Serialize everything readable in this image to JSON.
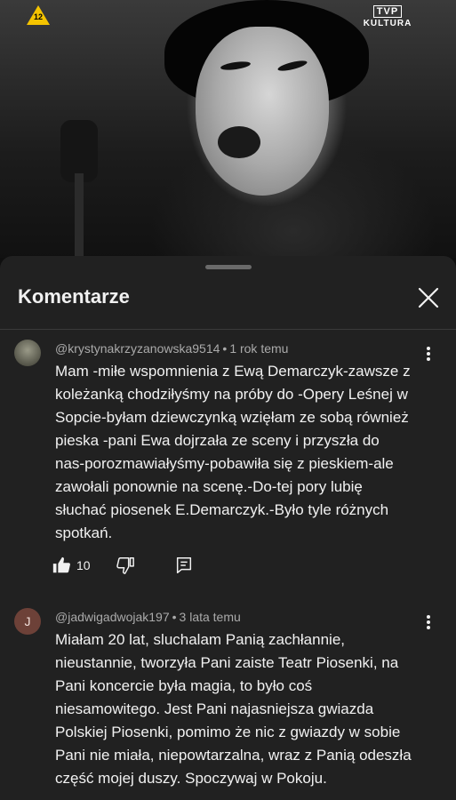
{
  "video": {
    "age_rating": "12",
    "channel_logo_top": "TVP",
    "channel_logo_bottom": "KULTURA"
  },
  "sheet": {
    "title": "Komentarze",
    "close_icon": "close-icon"
  },
  "comments": [
    {
      "author": "@krystynakrzyzanowska9514",
      "time": "1 rok temu",
      "avatar": "photo",
      "text_lines": [
        "Mam -miłe wspomnienia z Ewą Demarczyk-zawsze z",
        "koleżanką chodziłyśmy na próby do -Opery Leśnej w",
        "Sopcie-byłam dziewczynką wzięłam ze sobą również",
        "pieska -pani Ewa dojrzała ze sceny i przyszła do",
        "nas-porozmawiałyśmy-pobawiła się z pieskiem-ale",
        "zawołali ponownie na scenę.-Do-tej pory lubię",
        "słuchać piosenek E.Demarczyk.-Było tyle różnych",
        "spotkań."
      ],
      "likes": "10",
      "icons": [
        "thumb-up-icon",
        "thumb-down-icon",
        "reply-icon",
        "more-vert-icon"
      ]
    },
    {
      "author": "@jadwigadwojak197",
      "time": "3 lata temu",
      "avatar_letter": "J",
      "text_lines": [
        "Miałam 20 lat, sluchalam Panią zachłannie,",
        "nieustannie, tworzyła Pani zaiste Teatr Piosenki, na",
        "Pani koncercie była magia, to było coś",
        "niesamowitego. Jest Pani najasniejsza gwiazda",
        "Polskiej Piosenki, pomimo że nic z gwiazdy w sobie",
        "Pani nie miała, niepowtarzalna, wraz z Panią odeszła",
        "część mojej duszy. Spoczywaj w Pokoju."
      ],
      "icons": [
        "more-vert-icon"
      ]
    }
  ],
  "separator": "•",
  "colors": {
    "background": "#0f0f0f",
    "sheet": "#212121",
    "text": "#f1f1f1",
    "meta": "#aaaaaa",
    "avatar_letter_bg": "#6d4138"
  }
}
